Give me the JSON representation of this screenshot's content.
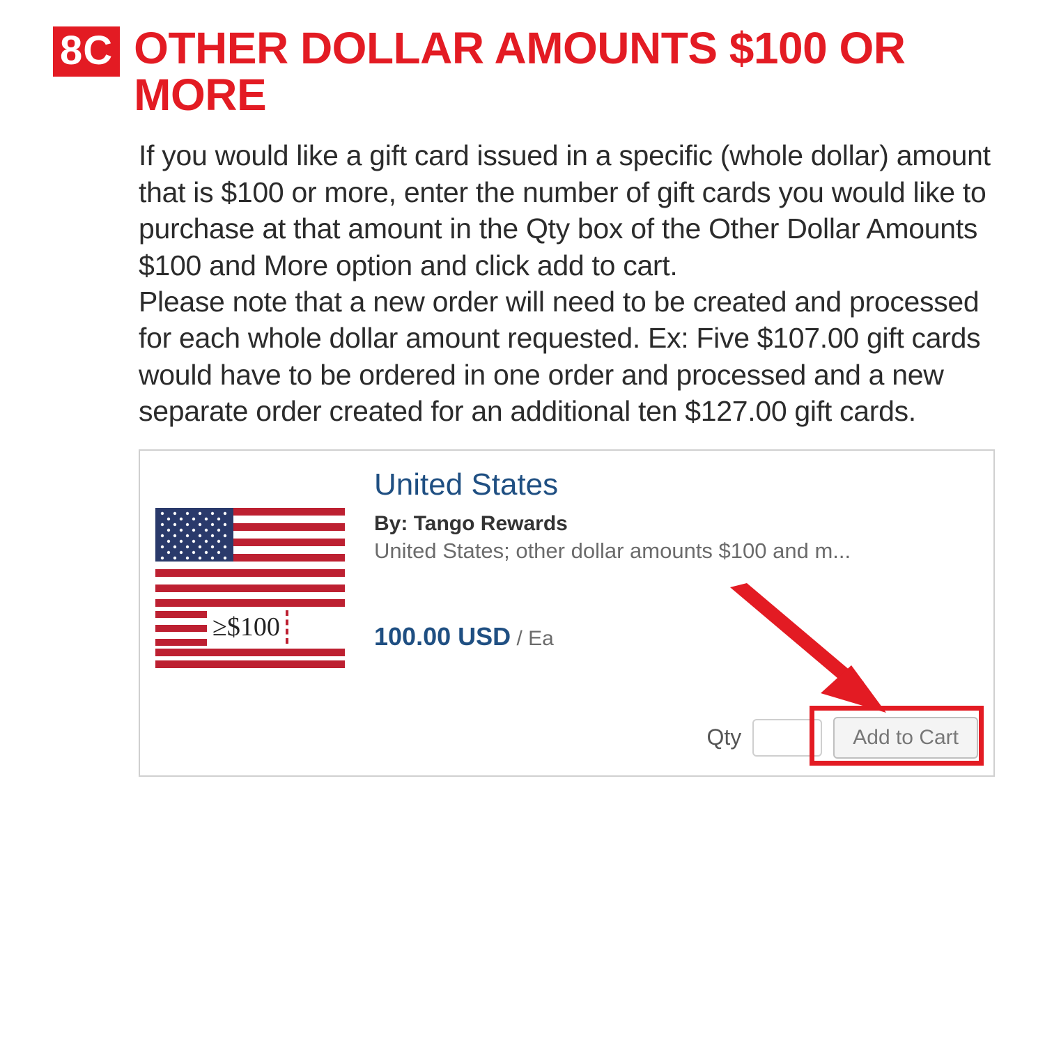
{
  "step": {
    "badge": "8C",
    "title": "OTHER DOLLAR AMOUNTS $100 OR MORE"
  },
  "paragraphs": {
    "p1": "If you would like a gift card issued in a specific (whole dollar) amount that is $100 or more, enter the number of gift cards you would like to purchase at that amount in the Qty box of the Other Dollar Amounts $100 and More option and click add to cart.",
    "p2": "Please note that a new order will need to be created and processed for each whole dollar amount requested.  Ex: Five $107.00 gift cards would have to be ordered in one order and processed and a new separate order created for an additional ten $127.00 gift cards."
  },
  "product": {
    "thumb_label": "≥$100",
    "title": "United States",
    "by_prefix": "By: ",
    "by": "Tango Rewards",
    "description": "United States; other dollar amounts $100 and m...",
    "price": "100.00 USD",
    "price_unit": " / Ea",
    "qty_label": "Qty",
    "qty_value": "",
    "add_label": "Add to Cart"
  }
}
